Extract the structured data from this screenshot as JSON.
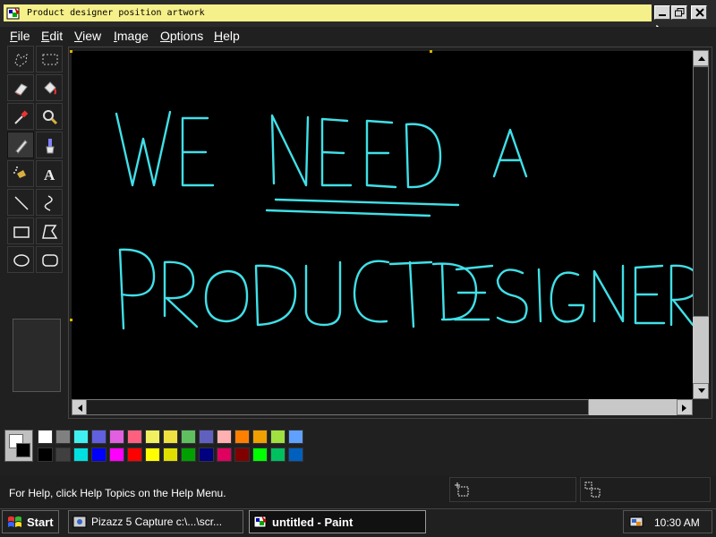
{
  "window": {
    "title": "Product designer position artwork",
    "controls": [
      "minimize",
      "maximize",
      "close"
    ]
  },
  "menubar": {
    "items": [
      {
        "label": "File",
        "accel": "F"
      },
      {
        "label": "Edit",
        "accel": "E"
      },
      {
        "label": "View",
        "accel": "V"
      },
      {
        "label": "Image",
        "accel": "I"
      },
      {
        "label": "Options",
        "accel": "O"
      },
      {
        "label": "Help",
        "accel": "H"
      }
    ]
  },
  "toolbox": {
    "tools": [
      "free-select-icon",
      "rect-select-icon",
      "eraser-icon",
      "fill-bucket-icon",
      "color-picker-icon",
      "magnifier-icon",
      "pencil-icon",
      "brush-icon",
      "airbrush-icon",
      "text-icon",
      "line-icon",
      "curve-icon",
      "rectangle-icon",
      "polygon-icon",
      "ellipse-icon",
      "rounded-rect-icon"
    ],
    "active_tool": "pencil-icon"
  },
  "canvas": {
    "background": "#000000",
    "ink_color": "#40e0e8",
    "drawing": {
      "line1": "WE NEED A",
      "line2": "PRODUCT DESIGNER"
    }
  },
  "palette": {
    "foreground": "#ffffff",
    "background": "#000000",
    "row1": [
      "#ffffff",
      "#808080",
      "#40f0f0",
      "#6060e0",
      "#e060e0",
      "#ff6080",
      "#f0f060",
      "#f0e040",
      "#60c060",
      "#6060c0",
      "#ffb0b0",
      "#ff8000",
      "#f0a000",
      "#a0e040",
      "#60a0ff"
    ],
    "row2": [
      "#000000",
      "#404040",
      "#00e0e0",
      "#0000ff",
      "#ff00ff",
      "#ff0000",
      "#ffff00",
      "#e0e000",
      "#00a000",
      "#000080",
      "#e00060",
      "#800000",
      "#00ff00",
      "#00c060",
      "#0060c0"
    ]
  },
  "statusbar": {
    "help_text": "For Help, click Help Topics on the Help Menu."
  },
  "taskbar": {
    "start_label": "Start",
    "tasks": [
      {
        "label": "Pizazz 5 Capture c:\\...\\scr...",
        "active": false
      },
      {
        "label": "untitled - Paint",
        "active": true
      }
    ],
    "clock": "10:30 AM"
  }
}
